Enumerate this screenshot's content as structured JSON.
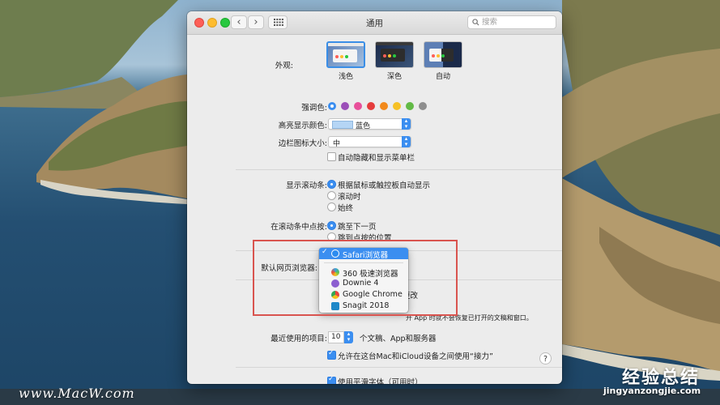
{
  "window": {
    "title": "通用",
    "search_placeholder": "搜索",
    "back_icon": "‹",
    "forward_icon": "›"
  },
  "appearance": {
    "label": "外观:",
    "options": [
      {
        "label": "浅色",
        "selected": true
      },
      {
        "label": "深色",
        "selected": false
      },
      {
        "label": "自动",
        "selected": false
      }
    ]
  },
  "accent": {
    "label": "强调色:",
    "colors": [
      "#3b8ef0",
      "#9b4fb8",
      "#e84f9a",
      "#e53c3c",
      "#f2891b",
      "#f6c125",
      "#62ba46",
      "#8e8e8e"
    ],
    "selected_index": 0
  },
  "highlight": {
    "label": "高亮显示颜色:",
    "value": "蓝色"
  },
  "sidebar_icon": {
    "label": "边栏图标大小:",
    "value": "中"
  },
  "auto_hide_menu": {
    "label": "自动隐藏和显示菜单栏",
    "checked": false
  },
  "scrollbars": {
    "label": "显示滚动条:",
    "options": [
      {
        "label": "根据鼠标或触控板自动显示",
        "selected": true
      },
      {
        "label": "滚动时",
        "selected": false
      },
      {
        "label": "始终",
        "selected": false
      }
    ]
  },
  "scroll_click": {
    "label": "在滚动条中点按:",
    "options": [
      {
        "label": "跳至下一页",
        "selected": true
      },
      {
        "label": "跳到点按的位置",
        "selected": false
      }
    ]
  },
  "default_browser": {
    "label": "默认网页浏览器:",
    "menu": [
      {
        "label": "Safari浏览器",
        "selected": true,
        "icon": "safari-icon",
        "color": "#2d8cf0"
      },
      {
        "label": "360 极速浏览器",
        "selected": false,
        "icon": "360-browser-icon",
        "color": "#3aa3e3"
      },
      {
        "label": "Downie 4",
        "selected": false,
        "icon": "downie-icon",
        "color": "#8c5fd0"
      },
      {
        "label": "Google Chrome",
        "selected": false,
        "icon": "chrome-icon",
        "color": "#e8453c"
      },
      {
        "label": "Snagit 2018",
        "selected": false,
        "icon": "snagit-icon",
        "color": "#1e88c8"
      }
    ],
    "check_mark": "✓"
  },
  "partial": {
    "close_docs_tail": "更改",
    "quit_tail": "开 App 时就不会恢复已打开的文稿和窗口。"
  },
  "recent": {
    "label": "最近使用的项目:",
    "value": "10",
    "suffix": "个文稿、App和服务器"
  },
  "handoff": {
    "label": "允许在这台Mac和iCloud设备之间使用“接力”",
    "checked": true
  },
  "font_smoothing": {
    "label": "使用平滑字体（可用时）",
    "checked": true
  },
  "help_label": "?",
  "watermarks": {
    "left": "www.MacW.com",
    "right_top": "经验总结",
    "right_bottom": "jingyanzongjie.com"
  }
}
